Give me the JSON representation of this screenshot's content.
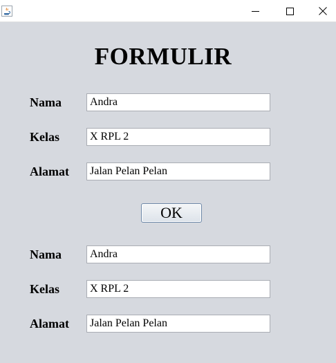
{
  "window": {
    "icons": {
      "app": "java-icon",
      "minimize": "minimize-icon",
      "maximize": "maximize-icon",
      "close": "close-icon"
    }
  },
  "form": {
    "title": "FORMULIR",
    "inputs": {
      "nama": {
        "label": "Nama",
        "value": "Andra"
      },
      "kelas": {
        "label": "Kelas",
        "value": "X RPL 2"
      },
      "alamat": {
        "label": "Alamat",
        "value": "Jalan Pelan Pelan"
      }
    },
    "ok_label": "OK",
    "outputs": {
      "nama": {
        "label": "Nama",
        "value": "Andra"
      },
      "kelas": {
        "label": "Kelas",
        "value": "X RPL 2"
      },
      "alamat": {
        "label": "Alamat",
        "value": "Jalan Pelan Pelan"
      }
    }
  },
  "colors": {
    "background": "#d6d9df",
    "titlebar": "#ffffff",
    "field_border": "#a9acb3",
    "button_border": "#6c87a7"
  }
}
